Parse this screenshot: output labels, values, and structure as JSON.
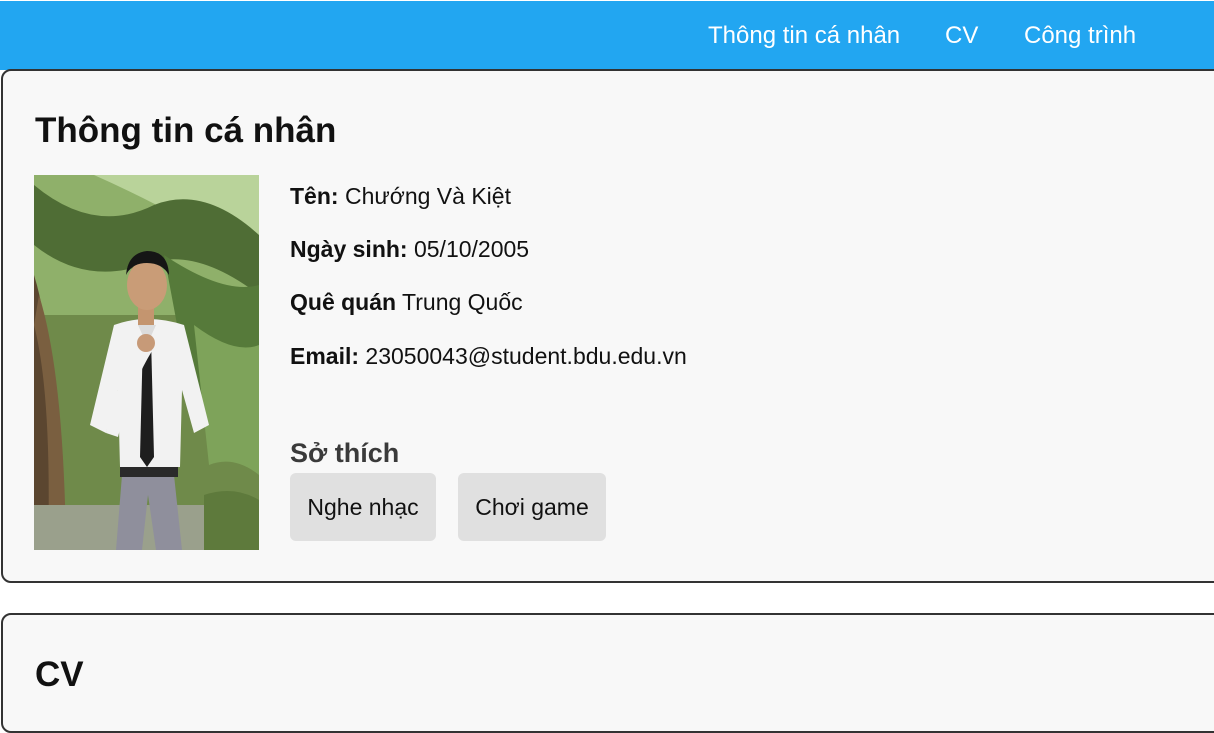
{
  "nav": {
    "items": [
      {
        "label": "Thông tin cá nhân"
      },
      {
        "label": "CV"
      },
      {
        "label": "Công trình"
      }
    ]
  },
  "profile": {
    "title": "Thông tin cá nhân",
    "fields": [
      {
        "label": "Tên:",
        "value": "Chướng Và Kiệt"
      },
      {
        "label": "Ngày sinh:",
        "value": "05/10/2005"
      },
      {
        "label": "Quê quán",
        "value": "Trung Quốc"
      },
      {
        "label": "Email:",
        "value": "23050043@student.bdu.edu.vn"
      }
    ],
    "hobbies_title": "Sở thích",
    "hobbies": [
      {
        "label": "Nghe nhạc"
      },
      {
        "label": "Chơi game"
      }
    ]
  },
  "cv": {
    "title": "CV"
  },
  "colors": {
    "navbar": "#22a6f1",
    "card_bg": "#f8f8f8",
    "card_border": "#333333",
    "tag_bg": "#e0e0e0"
  }
}
